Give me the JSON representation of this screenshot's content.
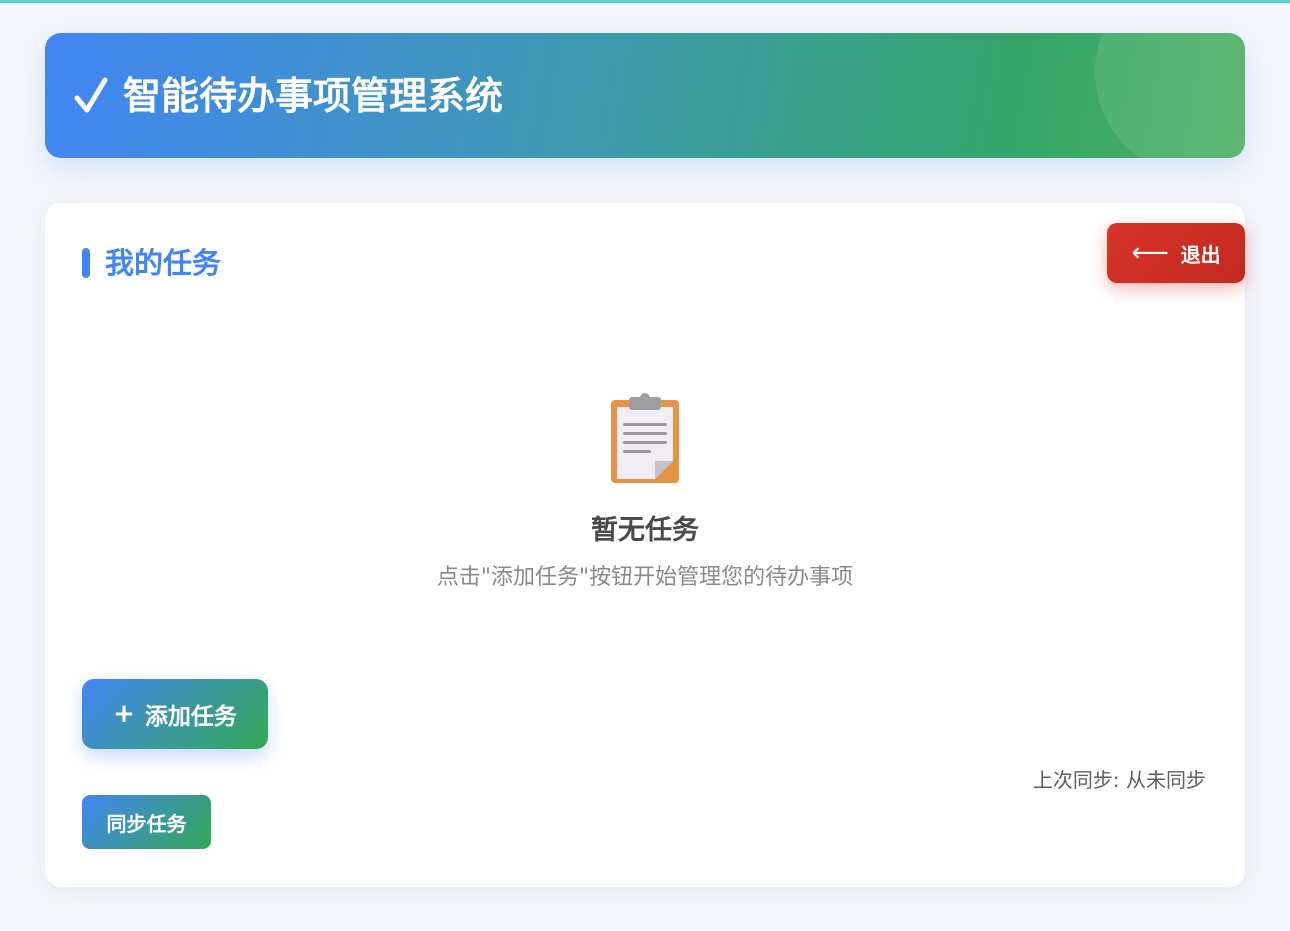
{
  "header": {
    "title": "智能待办事项管理系统",
    "icon": "check-icon"
  },
  "section": {
    "title": "我的任务"
  },
  "logout": {
    "label": "退出",
    "icon": "arrow-left-icon",
    "color": "#d9352a"
  },
  "empty_state": {
    "icon": "clipboard-icon",
    "title": "暂无任务",
    "hint": "点击\"添加任务\"按钮开始管理您的待办事项"
  },
  "add_task": {
    "label": "添加任务",
    "icon": "plus-icon"
  },
  "sync": {
    "status": "上次同步: 从未同步",
    "button_label": "同步任务"
  },
  "colors": {
    "primary": "#4285f4",
    "secondary": "#34a853",
    "danger": "#d9352a",
    "background": "#f4f6fb"
  }
}
